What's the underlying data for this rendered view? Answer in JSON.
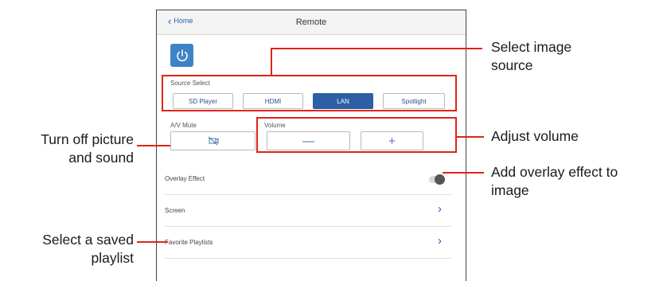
{
  "navbar": {
    "back_label": "Home",
    "title": "Remote"
  },
  "power": {
    "icon": "power-icon",
    "color": "#3d84c6"
  },
  "source_select": {
    "label": "Source Select",
    "options": [
      "SD Player",
      "HDMI",
      "LAN",
      "Spotlight"
    ],
    "selected": "LAN"
  },
  "av_mute": {
    "label": "A/V Mute",
    "icon": "av-mute-icon"
  },
  "volume": {
    "label": "Volume",
    "decrease": "—",
    "increase": "+"
  },
  "rows": {
    "overlay_effect": {
      "label": "Overlay Effect",
      "toggle_on": false
    },
    "screen": {
      "label": "Screen"
    },
    "favorite_playlists": {
      "label": "Favorite Playlists"
    }
  },
  "callouts": {
    "select_source": [
      "Select image",
      "source"
    ],
    "adjust_volume": "Adjust volume",
    "overlay": [
      "Add overlay effect to",
      "image"
    ],
    "mute": [
      "Turn off picture",
      "and sound"
    ],
    "playlist": [
      "Select a saved",
      "playlist"
    ]
  },
  "colors": {
    "highlight": "#e2231a",
    "selected_button": "#2d5fa6"
  }
}
